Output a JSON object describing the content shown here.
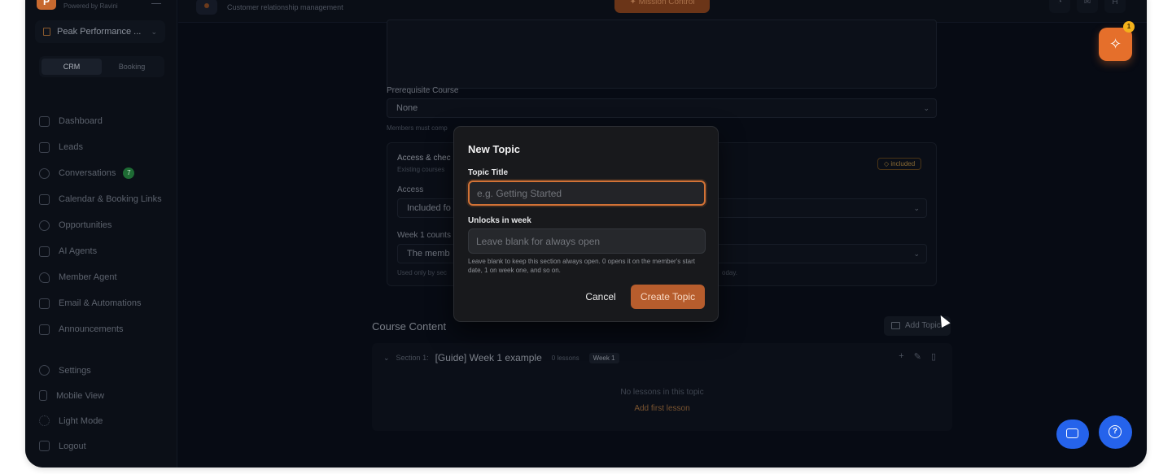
{
  "sidebar": {
    "powered_by": "Powered by Ravini",
    "org_name": "Peak Performance ...",
    "segments": [
      "CRM",
      "Booking"
    ],
    "nav": [
      {
        "label": "Dashboard",
        "icon": "home-icon"
      },
      {
        "label": "Leads",
        "icon": "users-icon"
      },
      {
        "label": "Conversations",
        "icon": "chat-icon",
        "badge": "7"
      },
      {
        "label": "Calendar & Booking Links",
        "icon": "calendar-icon"
      },
      {
        "label": "Opportunities",
        "icon": "target-icon"
      },
      {
        "label": "AI Agents",
        "icon": "monitor-icon"
      },
      {
        "label": "Member Agent",
        "icon": "heart-icon"
      },
      {
        "label": "Email & Automations",
        "icon": "mail-icon"
      },
      {
        "label": "Announcements",
        "icon": "mail-icon"
      }
    ],
    "bottom": [
      {
        "label": "Settings",
        "icon": "gear-icon"
      },
      {
        "label": "Mobile View",
        "icon": "phone-icon"
      },
      {
        "label": "Light Mode",
        "icon": "sun-icon"
      },
      {
        "label": "Logout",
        "icon": "logout-icon"
      }
    ]
  },
  "topbar": {
    "subtitle": "Customer relationship management",
    "mission_label": "Mission Control",
    "avatar": "H"
  },
  "form": {
    "prereq_label": "Prerequisite Course",
    "prereq_value": "None",
    "prereq_hint": "Members must comp",
    "access_title": "Access & chec",
    "access_sub": "Existing courses",
    "included_pill": "included",
    "access_label": "Access",
    "access_value": "Included fo",
    "week_label": "Week 1 counts",
    "week_value": "The memb",
    "week_hint_left": "Used only by sec",
    "week_hint_right": "oday."
  },
  "content": {
    "title": "Course Content",
    "add_topic": "Add Topic",
    "section_prefix": "Section 1:",
    "section_title": "[Guide] Week 1 example",
    "lesson_count": "0 lessons",
    "week_badge": "Week 1",
    "empty": "No lessons in this topic",
    "add_lesson": "Add first lesson"
  },
  "modal": {
    "title": "New Topic",
    "topic_label": "Topic Title",
    "topic_placeholder": "e.g. Getting Started",
    "unlock_label": "Unlocks in week",
    "unlock_placeholder": "Leave blank for always open",
    "hint": "Leave blank to keep this section always open. 0 opens it on the member's start date, 1 on week one, and so on.",
    "cancel": "Cancel",
    "create": "Create Topic"
  },
  "fab": {
    "ai_badge": "1"
  },
  "colors": {
    "accent": "#e56f2b",
    "primary_blue": "#2563eb",
    "focus_ring": "#d27236"
  }
}
